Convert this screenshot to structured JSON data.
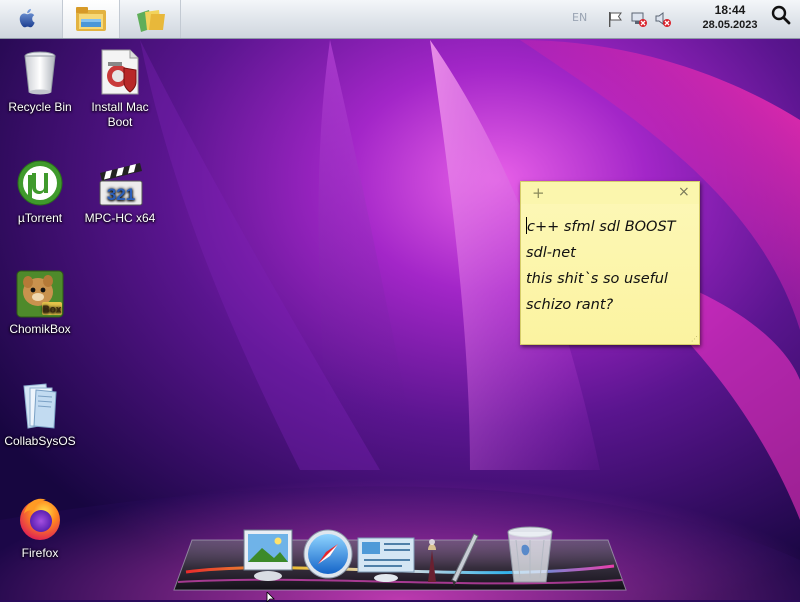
{
  "menubar": {
    "apple_menu": "apple-icon",
    "pinned": [
      "file-explorer-icon",
      "file-folders-icon"
    ],
    "tray": {
      "language": "EN",
      "icons": [
        "action-center-flag-icon",
        "network-disconnected-icon",
        "volume-muted-icon"
      ]
    },
    "clock": {
      "time": "18:44",
      "date": "28.05.2023"
    },
    "search": "search-icon"
  },
  "desktop_icons": [
    {
      "label": "Recycle Bin",
      "icon": "recycle-bin-icon"
    },
    {
      "label": "Install Mac Boot",
      "icon": "installer-icon"
    },
    {
      "label": "µTorrent",
      "icon": "utorrent-icon"
    },
    {
      "label": "MPC-HC x64",
      "icon": "mpc-hc-icon"
    },
    {
      "label": "ChomikBox",
      "icon": "chomikbox-icon",
      "badge": "Box"
    },
    {
      "label": "CollabSysOS",
      "icon": "folder-icon"
    },
    {
      "label": "Firefox",
      "icon": "firefox-icon"
    }
  ],
  "mpc_badge": "321",
  "sticky_note": {
    "add": "+",
    "close": "×",
    "lines": [
      "c++ sfml sdl BOOST",
      "sdl-net",
      "this shit`s so useful",
      "schizo rant?"
    ],
    "bg_color": "#fbf3a0"
  },
  "dock": {
    "items": [
      "photo-app-icon",
      "safari-icon",
      "dashboard-icon",
      "brush-icon",
      "pen-icon",
      "trash-icon"
    ]
  },
  "colors": {
    "wallpaper_dark": "#1a0850",
    "wallpaper_pink": "#d81fb8",
    "menubar": "#dfe4ea"
  }
}
